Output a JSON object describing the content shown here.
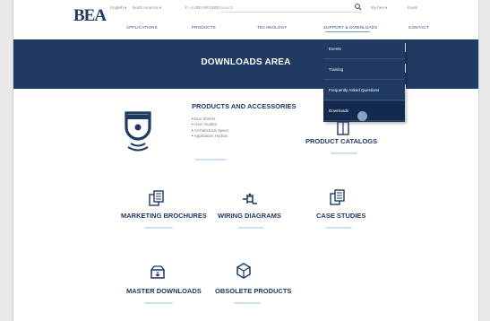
{
  "colors": {
    "brand": "#1f3a63",
    "accent": "#6fa0cf",
    "underline": "#cfe2f3"
  },
  "header": {
    "logo": "BEA",
    "language": "English",
    "region": "North America",
    "phone": "+1 000 000 0000",
    "search_placeholder": "Search",
    "my_bea": "My bea",
    "extra_link": "Event"
  },
  "nav": {
    "items": [
      "APPLICATIONS",
      "PRODUCTS",
      "TECHNOLOGY",
      "SUPPORT & DOWNLOADS",
      "CONTACT"
    ]
  },
  "banner": {
    "title": "DOWNLOADS AREA"
  },
  "dropdown": {
    "items": [
      "Events",
      "Training",
      "Frequently Asked Questions",
      "Downloads"
    ],
    "active_index": 3
  },
  "sections": {
    "products": {
      "title": "PRODUCTS AND ACCESSORIES",
      "bullets": [
        "Dun Sheets",
        "User Guides",
        "Architectural Specs",
        "Application Hydras"
      ],
      "icon": "sensor-icon"
    },
    "catalogs": {
      "title": "PRODUCT CATALOGS",
      "icon": "book-icon"
    },
    "brochures": {
      "title": "MARKETING BROCHURES",
      "icon": "documents-icon"
    },
    "wiring": {
      "title": "WIRING DIAGRAMS",
      "icon": "wiring-icon"
    },
    "cases": {
      "title": "CASE STUDIES",
      "icon": "documents-icon"
    },
    "master": {
      "title": "MASTER DOWNLOADS",
      "icon": "download-box-icon"
    },
    "obsolete": {
      "title": "OBSOLETE PRODUCTS",
      "icon": "box-icon"
    }
  }
}
